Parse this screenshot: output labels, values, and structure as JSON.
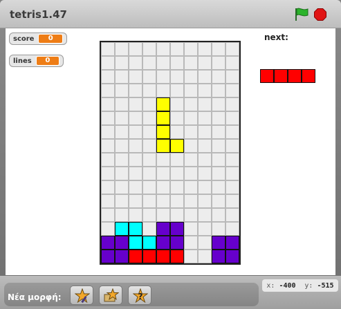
{
  "window": {
    "title": "tetris1.47",
    "icons": [
      "green-flag-icon",
      "stop-sign-icon"
    ],
    "colors": {
      "flag": "#2bb32b",
      "stop": "#e01414"
    }
  },
  "monitors": [
    {
      "label": "score",
      "value": "0"
    },
    {
      "label": "lines",
      "value": "0"
    }
  ],
  "next": {
    "label": "next:",
    "piece_color": "#ff0000",
    "piece_cells": 4
  },
  "board": {
    "columns": 10,
    "rows": 16,
    "palette": {
      "Y": "#ffff00",
      "C": "#00ffff",
      "P": "#6600cc",
      "R": "#ff0000"
    },
    "rows_data": [
      "..........",
      "..........",
      "..........",
      "..........",
      "....Y.....",
      "....Y.....",
      "....Y.....",
      "....YY....",
      "..........",
      "..........",
      "..........",
      "..........",
      "..........",
      ".CC.PP....",
      "PPCCPP..PP",
      "PPRRRR..PP"
    ]
  },
  "bottom": {
    "new_sprite_label": "Νέα μορφή:",
    "buttons": [
      "paint-new-sprite-button",
      "choose-sprite-from-file-button",
      "surprise-sprite-button"
    ],
    "mouse_x_label": "x:",
    "mouse_x": "-400",
    "mouse_y_label": "y:",
    "mouse_y": "-515"
  }
}
